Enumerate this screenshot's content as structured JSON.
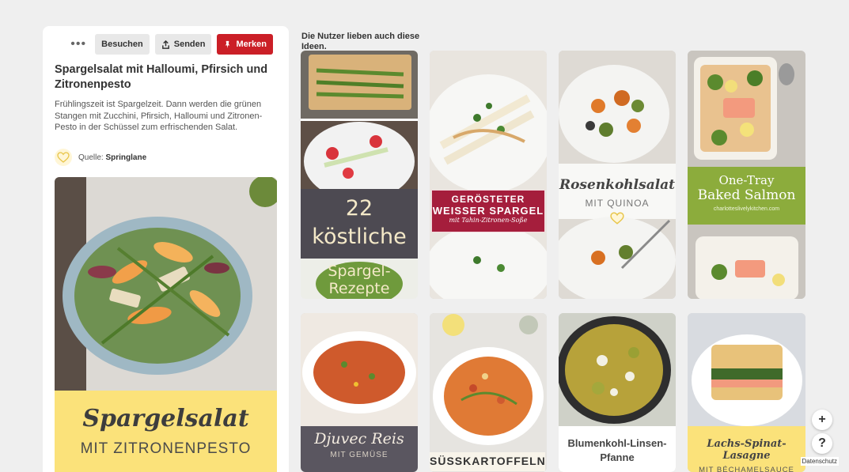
{
  "detail": {
    "more_label": "•••",
    "visit_label": "Besuchen",
    "send_label": "Senden",
    "save_label": "Merken",
    "title": "Spargelsalat mit Halloumi, Pfirsich und Zitronenpesto",
    "description": "Frühlingszeit ist Spargelzeit. Dann werden die grünen Stangen mit Zucchini, Pfirsich, Halloumi und Zitronen-Pesto in der Schüssel zum erfrischenden Salat.",
    "source_prefix": "Quelle:",
    "source_name": "Springlane",
    "hero_title": "Spargelsalat",
    "hero_subtitle": "MIT ZITRONENPESTO"
  },
  "grid": {
    "heading": "Die Nutzer lieben auch diese Ideen.",
    "pins": [
      {
        "line1": "22 köstliche",
        "line2": "Spargel-Rezepte"
      },
      {
        "line1": "GERÖSTETER",
        "line2": "WEISSER SPARGEL",
        "line3": "mit Tahin-Zitronen-Soße"
      },
      {
        "line1": "Rosenkohlsalat",
        "line2": "MIT QUINOA"
      },
      {
        "line1": "One-Tray",
        "line2": "Baked Salmon",
        "line3": "charlotteslivelykitchen.com"
      },
      {
        "line1": "Djuvec Reis",
        "line2": "MIT GEMÜSE"
      },
      {
        "line1": "SÜSSKARTOFFELN"
      },
      {
        "line1": "Blumenkohl-Linsen-",
        "line2": "Pfanne"
      },
      {
        "line1": "Lachs-Spinat-Lasagne",
        "line2": "MIT BÉCHAMELSAUCE"
      }
    ]
  },
  "fab": {
    "plus": "+",
    "help": "?"
  },
  "footer": {
    "privacy": "Datenschutz"
  },
  "colors": {
    "save_red": "#cb1f27",
    "hero_yellow": "#fbe27a"
  }
}
